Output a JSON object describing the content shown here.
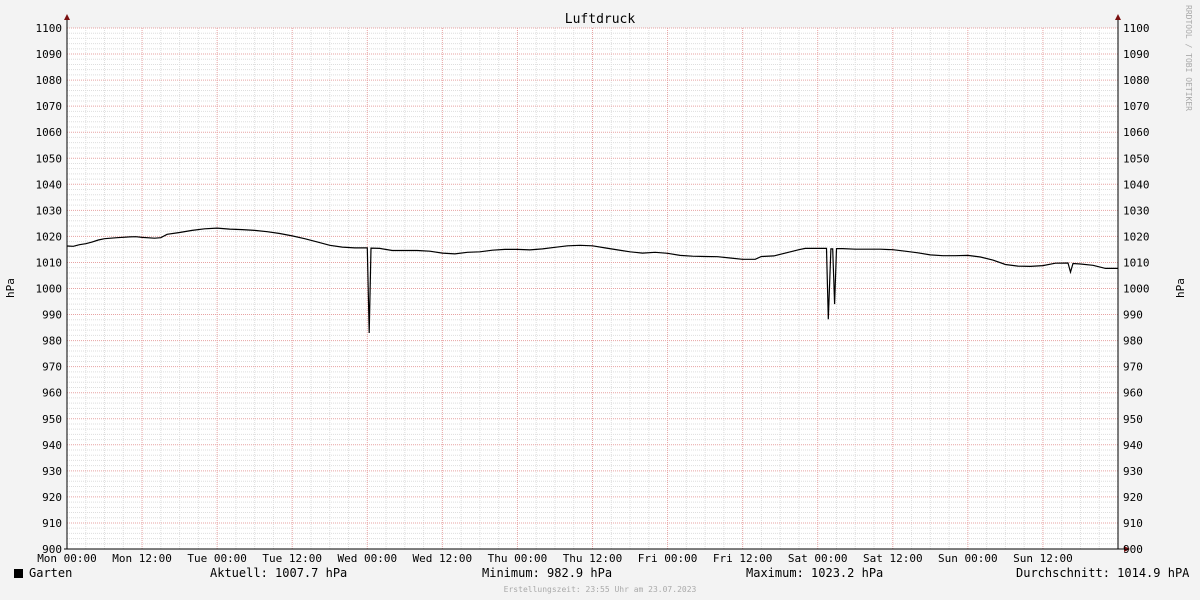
{
  "chart_data": {
    "type": "line",
    "title": "Luftdruck",
    "ylabel": "hPa",
    "ylim": [
      900,
      1100
    ],
    "yticks": [
      900,
      910,
      920,
      930,
      940,
      950,
      960,
      970,
      980,
      990,
      1000,
      1010,
      1020,
      1030,
      1040,
      1050,
      1060,
      1070,
      1080,
      1090,
      1100
    ],
    "xticks": [
      "Mon 00:00",
      "Mon 12:00",
      "Tue 00:00",
      "Tue 12:00",
      "Wed 00:00",
      "Wed 12:00",
      "Thu 00:00",
      "Thu 12:00",
      "Fri 00:00",
      "Fri 12:00",
      "Sat 00:00",
      "Sat 12:00",
      "Sun 00:00",
      "Sun 12:00"
    ],
    "xrange_hours": [
      0,
      168
    ],
    "grid": true,
    "watermark": "RRDTOOL / TOBI OETIKER",
    "series": [
      {
        "name": "Garten",
        "color": "#000000",
        "points": [
          [
            0,
            1016.3
          ],
          [
            1,
            1016.2
          ],
          [
            2,
            1016.8
          ],
          [
            3,
            1017.2
          ],
          [
            4,
            1017.8
          ],
          [
            5,
            1018.6
          ],
          [
            6,
            1019.1
          ],
          [
            8,
            1019.5
          ],
          [
            10,
            1019.8
          ],
          [
            11,
            1019.9
          ],
          [
            12,
            1019.6
          ],
          [
            14,
            1019.3
          ],
          [
            15,
            1019.5
          ],
          [
            16,
            1020.8
          ],
          [
            18,
            1021.5
          ],
          [
            20,
            1022.3
          ],
          [
            22,
            1022.9
          ],
          [
            24,
            1023.2
          ],
          [
            26,
            1022.8
          ],
          [
            28,
            1022.6
          ],
          [
            30,
            1022.3
          ],
          [
            32,
            1021.8
          ],
          [
            34,
            1021.1
          ],
          [
            36,
            1020.2
          ],
          [
            38,
            1019.1
          ],
          [
            40,
            1017.9
          ],
          [
            42,
            1016.6
          ],
          [
            44,
            1015.9
          ],
          [
            46,
            1015.6
          ],
          [
            48,
            1015.6
          ],
          [
            48.3,
            982.9
          ],
          [
            48.6,
            1015.5
          ],
          [
            50,
            1015.4
          ],
          [
            52,
            1014.6
          ],
          [
            54,
            1014.6
          ],
          [
            56,
            1014.6
          ],
          [
            58,
            1014.3
          ],
          [
            60,
            1013.6
          ],
          [
            62,
            1013.3
          ],
          [
            64,
            1013.9
          ],
          [
            66,
            1014.1
          ],
          [
            68,
            1014.7
          ],
          [
            70,
            1015.0
          ],
          [
            72,
            1015.0
          ],
          [
            74,
            1014.8
          ],
          [
            76,
            1015.2
          ],
          [
            78,
            1015.8
          ],
          [
            80,
            1016.4
          ],
          [
            82,
            1016.6
          ],
          [
            84,
            1016.4
          ],
          [
            86,
            1015.6
          ],
          [
            88,
            1014.8
          ],
          [
            90,
            1014.1
          ],
          [
            92,
            1013.6
          ],
          [
            94,
            1013.9
          ],
          [
            96,
            1013.5
          ],
          [
            98,
            1012.7
          ],
          [
            100,
            1012.4
          ],
          [
            102,
            1012.3
          ],
          [
            104,
            1012.2
          ],
          [
            106,
            1011.7
          ],
          [
            108,
            1011.2
          ],
          [
            110,
            1011.2
          ],
          [
            111,
            1012.3
          ],
          [
            113,
            1012.5
          ],
          [
            115,
            1013.7
          ],
          [
            117,
            1014.9
          ],
          [
            118,
            1015.4
          ],
          [
            121.4,
            1015.4
          ],
          [
            121.7,
            988.2
          ],
          [
            122.1,
            1015.2
          ],
          [
            122.4,
            1015.2
          ],
          [
            122.7,
            994.0
          ],
          [
            123.0,
            1015.3
          ],
          [
            124,
            1015.3
          ],
          [
            126,
            1015.1
          ],
          [
            128,
            1015.1
          ],
          [
            130,
            1015.1
          ],
          [
            132,
            1014.9
          ],
          [
            134,
            1014.3
          ],
          [
            136,
            1013.7
          ],
          [
            138,
            1012.9
          ],
          [
            140,
            1012.6
          ],
          [
            142,
            1012.6
          ],
          [
            144,
            1012.7
          ],
          [
            146,
            1012.1
          ],
          [
            148,
            1010.9
          ],
          [
            150,
            1009.2
          ],
          [
            152,
            1008.6
          ],
          [
            154,
            1008.5
          ],
          [
            156,
            1008.8
          ],
          [
            158,
            1009.7
          ],
          [
            160,
            1009.8
          ],
          [
            160.4,
            1006.3
          ],
          [
            160.8,
            1009.6
          ],
          [
            162,
            1009.4
          ],
          [
            164,
            1008.9
          ],
          [
            166,
            1007.7
          ],
          [
            168,
            1007.7
          ]
        ]
      }
    ]
  },
  "legend": {
    "series_name": "Garten",
    "aktuell": "Aktuell: 1007.7 hPa",
    "minimum": "Minimum: 982.9 hPa",
    "maximum": "Maximum: 1023.2 hPa",
    "durchschnitt": "Durchschnitt: 1014.9 hPA"
  },
  "footer": {
    "created": "Erstellungszeit: 23:55 Uhr am 23.07.2023"
  }
}
